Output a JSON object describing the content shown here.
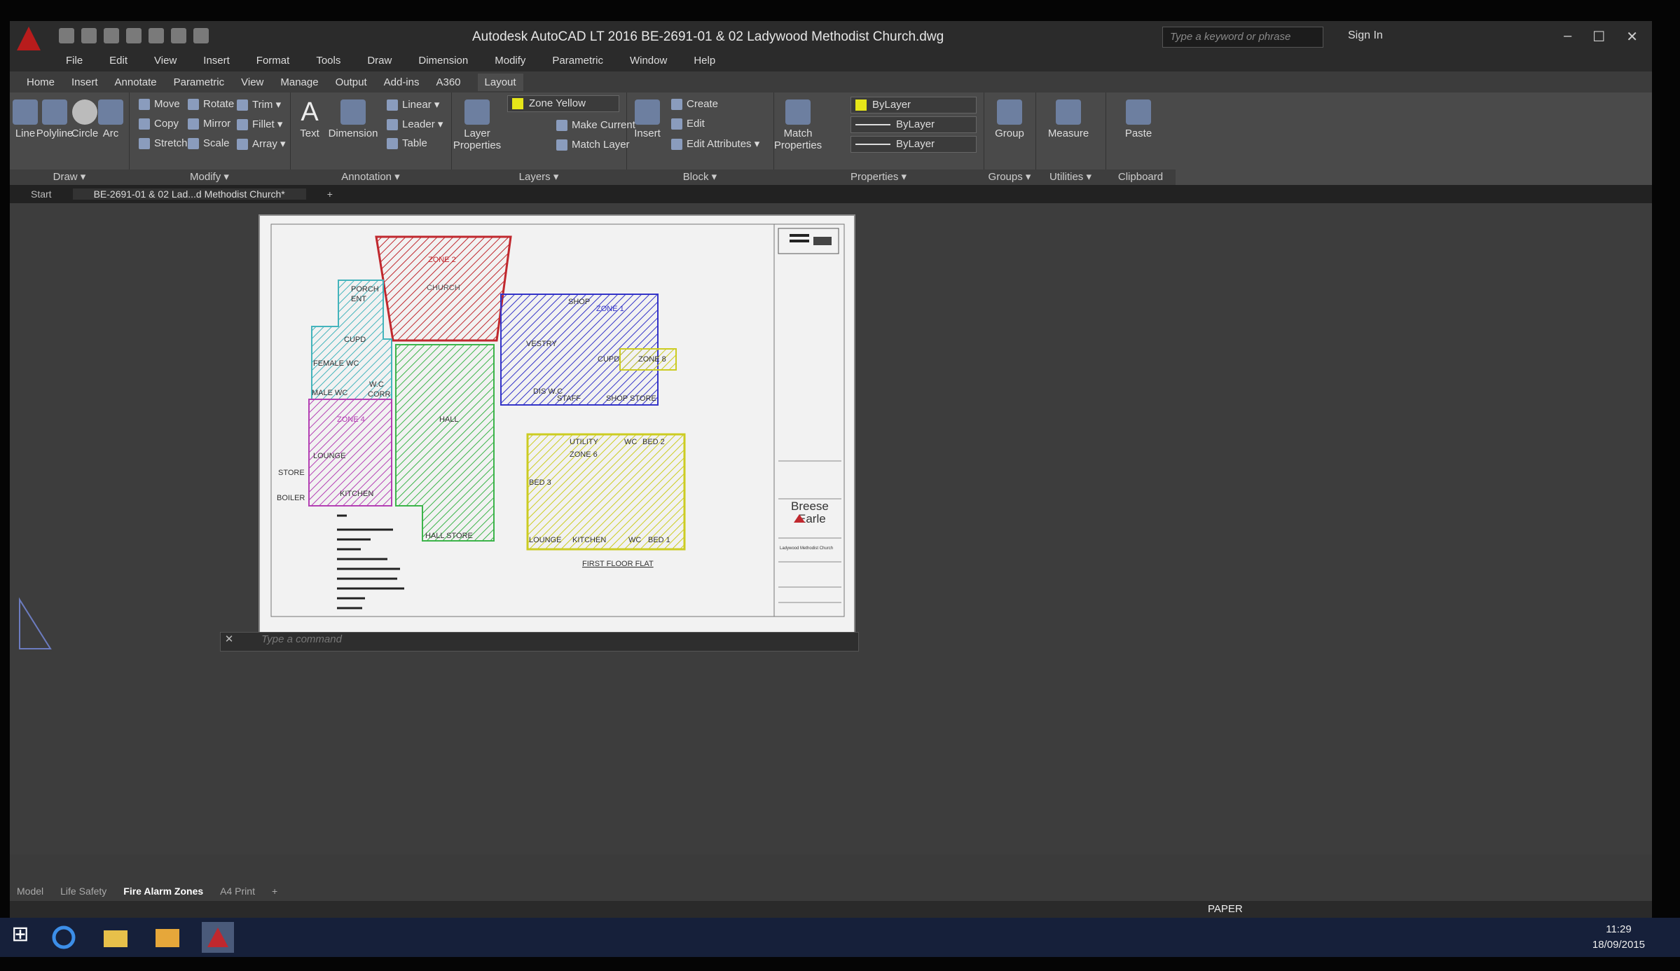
{
  "window": {
    "title": "Autodesk AutoCAD LT 2016    BE-2691-01 & 02 Ladywood Methodist Church.dwg",
    "search_placeholder": "Type a keyword or phrase",
    "signin": "Sign In",
    "controls": [
      "–",
      "☐",
      "✕"
    ]
  },
  "menu": [
    "File",
    "Edit",
    "View",
    "Insert",
    "Format",
    "Tools",
    "Draw",
    "Dimension",
    "Modify",
    "Parametric",
    "Window",
    "Help"
  ],
  "ribbon_tabs": [
    "Home",
    "Insert",
    "Annotate",
    "Parametric",
    "View",
    "Manage",
    "Output",
    "Add-ins",
    "A360",
    "Layout"
  ],
  "ribbon_active_tab": "Layout",
  "panels": {
    "draw": {
      "title": "Draw ▾",
      "tools": [
        "Line",
        "Polyline",
        "Circle",
        "Arc"
      ]
    },
    "modify": {
      "title": "Modify ▾",
      "tools": [
        "Move",
        "Rotate",
        "Trim ▾",
        "Copy",
        "Mirror",
        "Fillet ▾",
        "Stretch",
        "Scale",
        "Array ▾"
      ]
    },
    "annotation": {
      "title": "Annotation ▾",
      "big": [
        "Text",
        "Dimension"
      ],
      "tools": [
        "Linear ▾",
        "Leader ▾",
        "Table"
      ]
    },
    "layers": {
      "title": "Layers ▾",
      "big": "Layer Properties",
      "current_layer": "Zone Yellow",
      "tools": [
        "Make Current",
        "Match Layer"
      ]
    },
    "block": {
      "title": "Block ▾",
      "big": "Insert",
      "tools": [
        "Create",
        "Edit",
        "Edit Attributes ▾"
      ]
    },
    "properties": {
      "title": "Properties ▾",
      "big": "Match Properties",
      "color": "ByLayer",
      "linetype": "ByLayer",
      "lineweight": "ByLayer"
    },
    "groups": {
      "title": "Groups ▾",
      "big": "Group"
    },
    "utilities": {
      "title": "Utilities ▾",
      "big": "Measure"
    },
    "clipboard": {
      "title": "Clipboard",
      "big": "Paste"
    }
  },
  "doc_tabs": [
    "Start",
    "BE-2691-01 & 02 Lad...d Methodist Church*",
    "+"
  ],
  "drawing": {
    "rooms": {
      "zone2": "ZONE 2",
      "church": "CHURCH",
      "porch": "PORCH",
      "ent": "ENT",
      "cupd": "CUPD",
      "female_wc": "FEMALE WC",
      "male_wc": "MALE WC",
      "wc_corr_1": "W.C",
      "wc_corr_2": "CORR",
      "zone1": "ZONE 1",
      "shop": "SHOP",
      "vestry": "VESTRY",
      "cupd2": "CUPD",
      "zone8": "ZONE 8",
      "shop_store": "SHOP STORE",
      "dis_wc": "DIS W.C",
      "staff": "STAFF",
      "hall": "HALL",
      "zone4": "ZONE 4",
      "lounge": "LOUNGE",
      "kitchen": "KITCHEN",
      "store": "STORE",
      "boiler": "BOILER",
      "hall_store": "HALL STORE",
      "utility": "UTILITY",
      "zone6": "ZONE 6",
      "wc_flat": "WC",
      "bed2": "BED 2",
      "bed3": "BED 3",
      "lounge_flat": "LOUNGE",
      "kitchen_flat": "KITCHEN",
      "wc_flat2": "WC",
      "bed1": "BED 1",
      "first_floor": "FIRST FLOOR FLAT"
    },
    "zone_colors": {
      "red": "#c0282e",
      "blue": "#3434c8",
      "green": "#3cb44a",
      "cyan": "#44b4bc",
      "magenta": "#b440b4",
      "yellow": "#cccc22"
    },
    "title_block": {
      "company1": "Breese",
      "company2": "Earle",
      "project": "Ladywood Methodist Church"
    }
  },
  "command_placeholder": "Type a command",
  "layout_tabs": [
    "Model",
    "Life Safety",
    "Fire Alarm Zones",
    "A4 Print",
    "+"
  ],
  "layout_active": "Fire Alarm Zones",
  "status": {
    "space": "PAPER"
  },
  "clock": {
    "time": "11:29",
    "date": "18/09/2015"
  }
}
